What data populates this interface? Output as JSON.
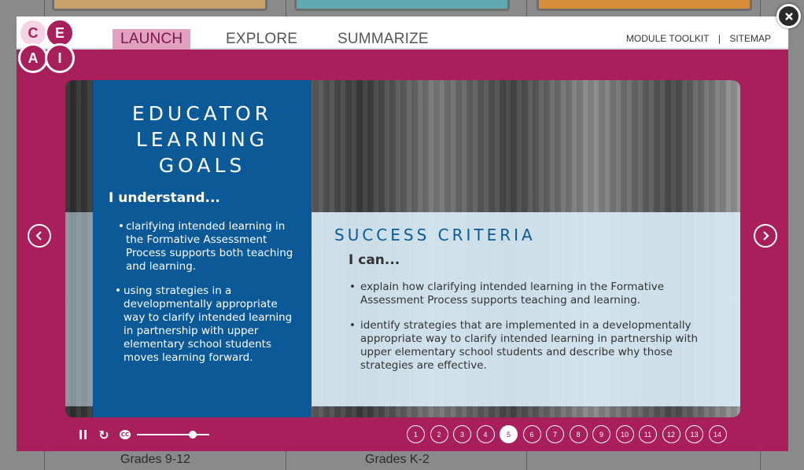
{
  "modal": {
    "nav_tabs": [
      {
        "label": "LAUNCH",
        "active": true
      },
      {
        "label": "EXPLORE",
        "active": false
      },
      {
        "label": "SUMMARIZE",
        "active": false
      }
    ],
    "toolbar": {
      "module_toolkit": "MODULE TOOLKIT",
      "separator": "|",
      "sitemap": "SITEMAP"
    },
    "logo": {
      "letters": [
        "C",
        "E",
        "A",
        "I"
      ]
    },
    "close_label": "✕",
    "colors": {
      "brand": "#a81f5c",
      "panel_blue": "#0b5a97",
      "criteria_bg": "#d6e9f3"
    }
  },
  "slide": {
    "goals_title_lines": [
      "EDUCATOR",
      "LEARNING",
      "GOALS"
    ],
    "understand_heading": "I understand...",
    "understand_bullets": [
      "clarifying intended learning in the Formative Assessment Process supports both teaching and learning.",
      "using strategies in a developmentally appropriate way to clarify intended learning in partnership with upper elementary school students moves learning forward."
    ],
    "criteria_title": "SUCCESS CRITERIA",
    "ican_heading": "I can...",
    "criteria_bullets": [
      "explain how clarifying intended learning in the Formative Assessment Process supports teaching and learning.",
      "identify strategies that are implemented in a developmentally appropriate way to clarify intended learning in partnership with upper elementary school students and describe why those strategies are effective."
    ]
  },
  "controls": {
    "prev_icon": "‹",
    "next_icon": "›",
    "replay_icon": "↻",
    "cc_label": "CC",
    "volume_level": 0.72
  },
  "pager": {
    "pages": [
      "1",
      "2",
      "3",
      "4",
      "5",
      "6",
      "7",
      "8",
      "9",
      "10",
      "11",
      "12",
      "13",
      "14"
    ],
    "current": "5"
  },
  "background": {
    "captions": [
      "Grades 9-12",
      "Grades K-2"
    ]
  }
}
